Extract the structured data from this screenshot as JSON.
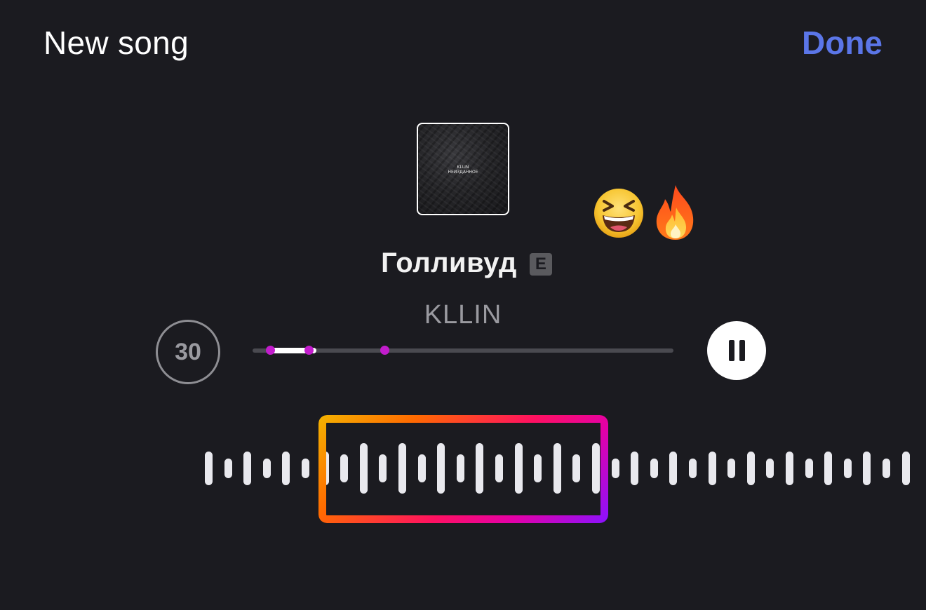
{
  "header": {
    "title": "New song",
    "done_label": "Done"
  },
  "album": {
    "art_text_line1": "KLLIN",
    "art_text_line2": "НЕИЗДАННОЕ"
  },
  "reactions": {
    "icons": [
      "grinning-squinting-face-icon",
      "fire-icon"
    ]
  },
  "song": {
    "title": "Голливуд",
    "explicit_label": "E",
    "artist": "KLLIN"
  },
  "player": {
    "clip_duration": "30",
    "progress_fraction": 0.15,
    "state": "playing",
    "pause_icon": "pause-icon"
  },
  "colors": {
    "background": "#1b1b20",
    "accent": "#5b76e8",
    "marker": "#c21ccc",
    "selection_gradient": [
      "#f4b400",
      "#ff6a00",
      "#ff1160",
      "#e400a6",
      "#8a12ff"
    ]
  }
}
